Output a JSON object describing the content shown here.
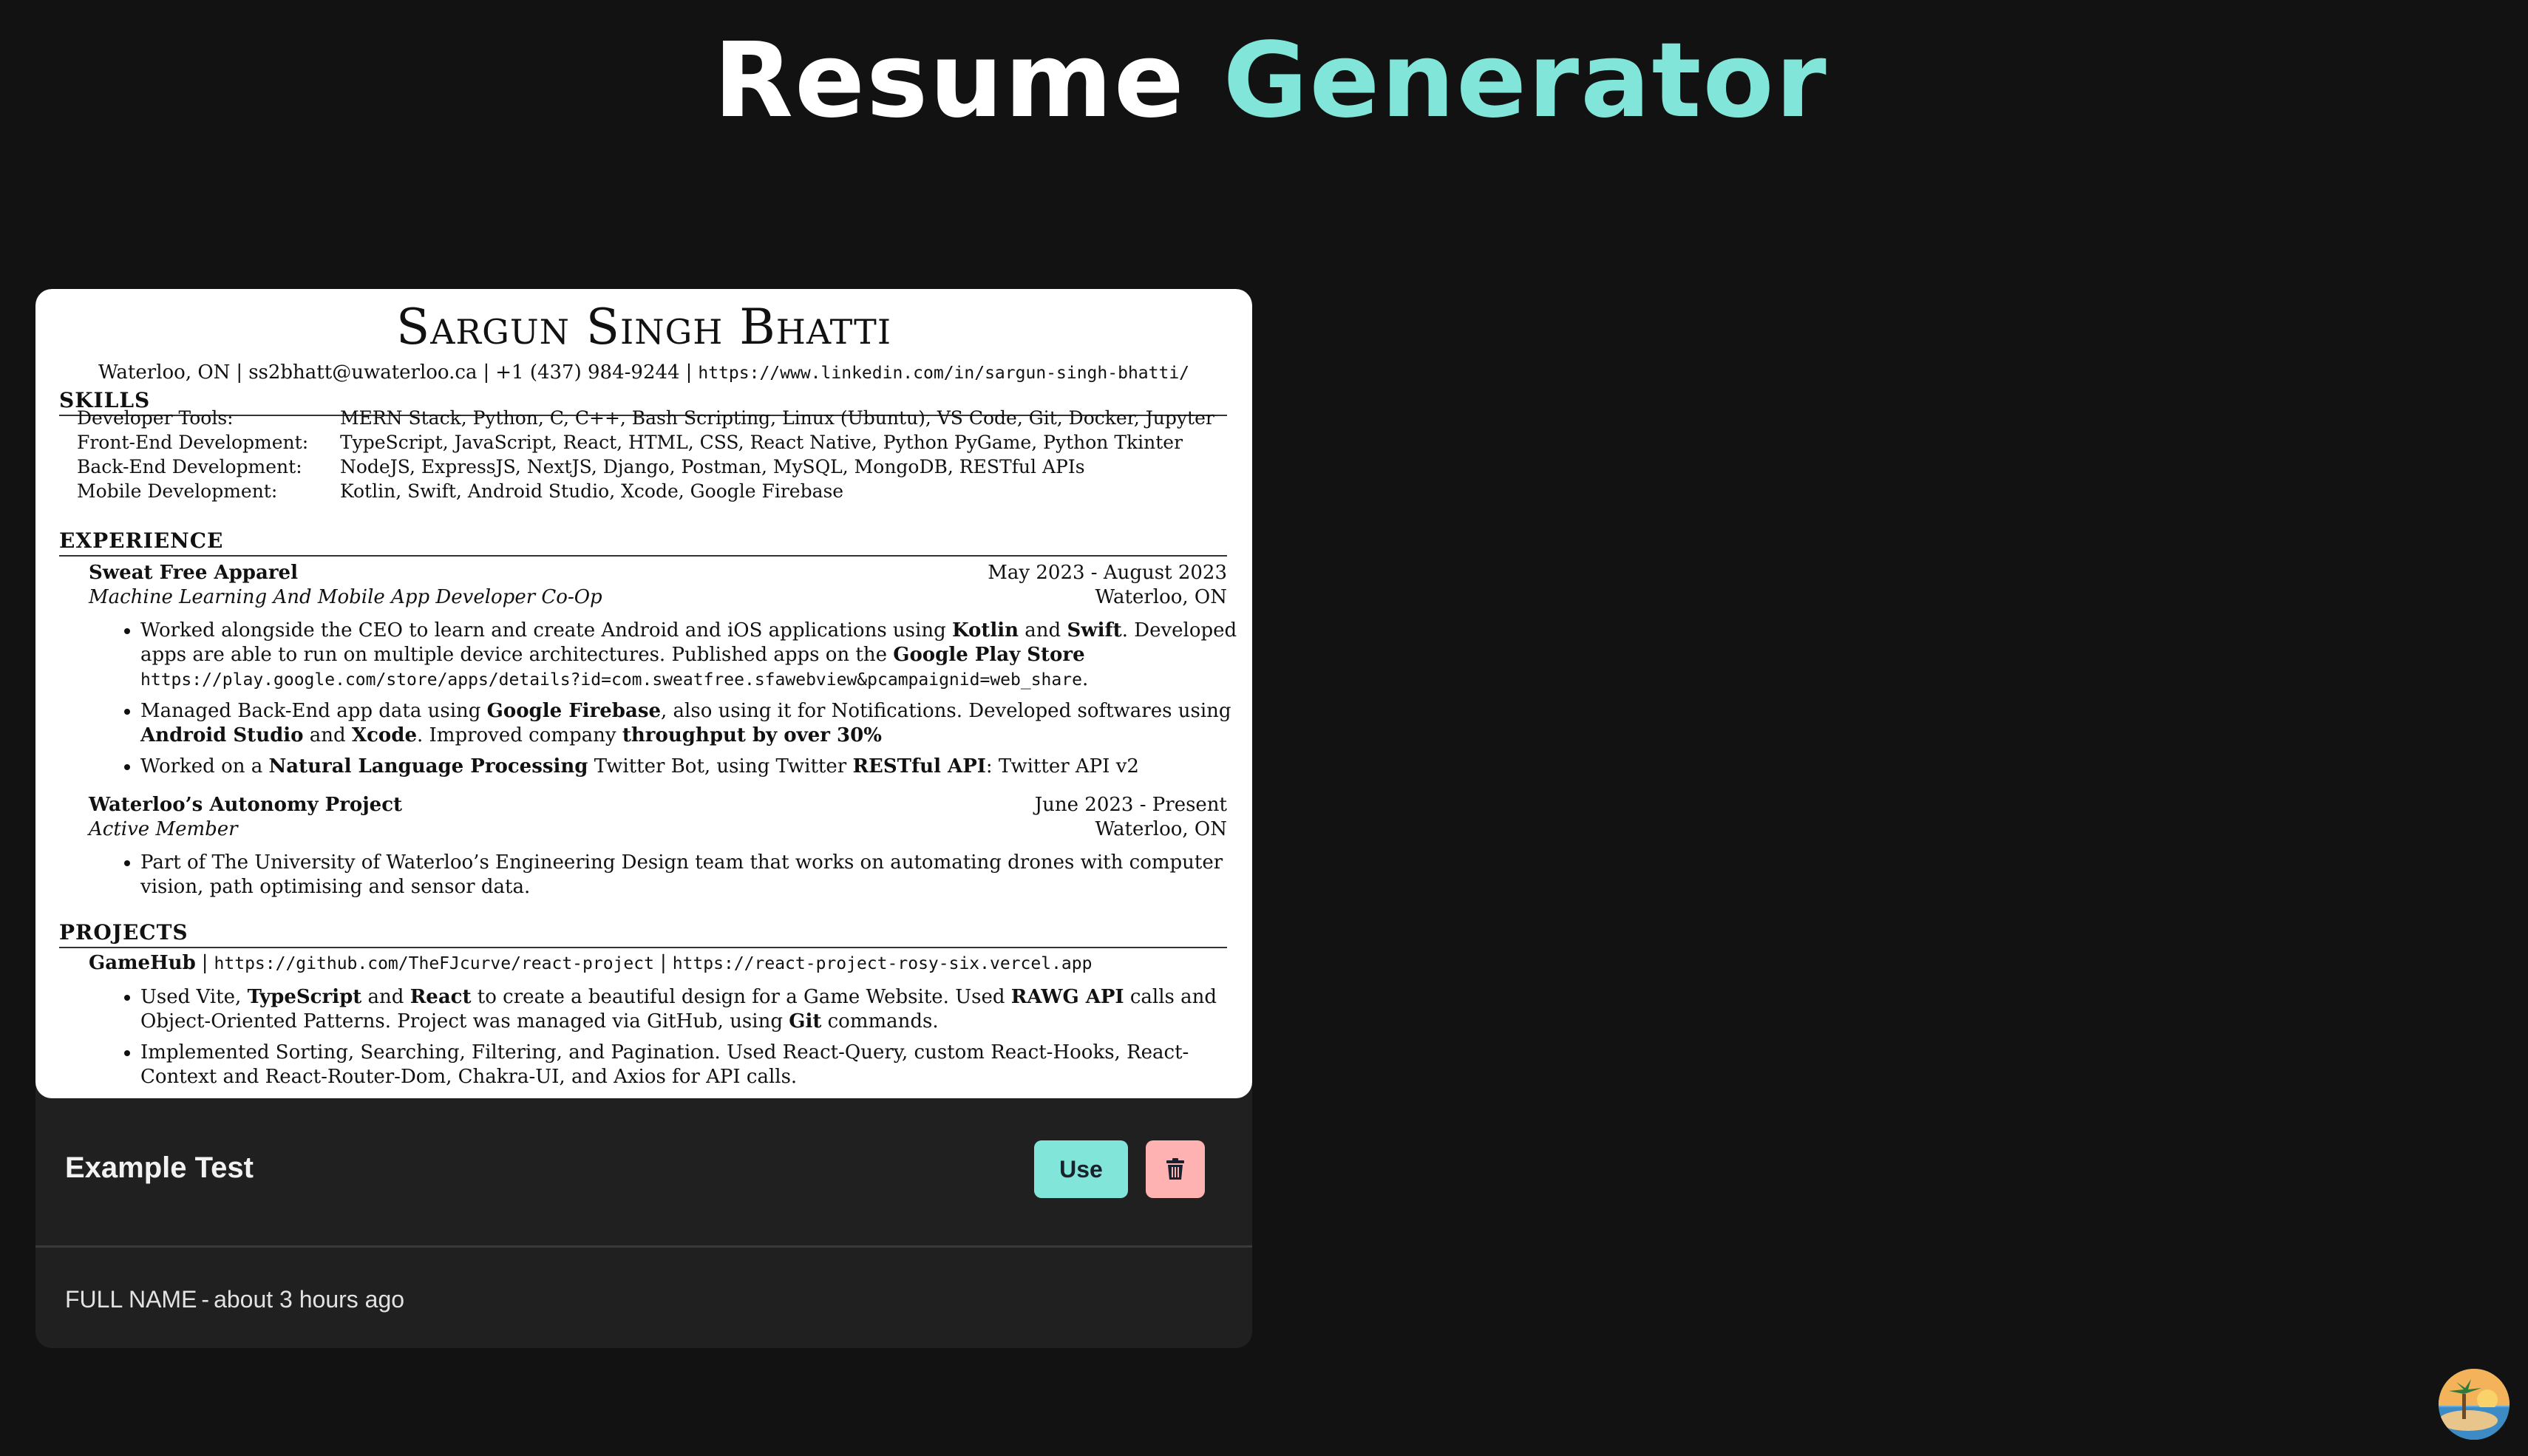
{
  "app": {
    "title_part_1": "Resume",
    "title_part_2": "Generator"
  },
  "card": {
    "title": "Example Test",
    "use_label": "Use",
    "delete_icon": "trash-icon",
    "author": "FULL NAME",
    "separator": "-",
    "time_ago": "about 3 hours ago"
  },
  "resume": {
    "name": "Sargun Singh Bhatti",
    "contact": {
      "location": "Waterloo, ON",
      "email": "ss2bhatt@uwaterloo.ca",
      "phone": "+1 (437) 984-9244",
      "linkedin": "https://www.linkedin.com/in/sargun-singh-bhatti/"
    },
    "sections": {
      "skills": "SKILLS",
      "experience": "EXPERIENCE",
      "projects": "PROJECTS"
    },
    "skills": [
      {
        "label": "Developer Tools:",
        "value": "MERN Stack, Python, C, C++, Bash Scripting, Linux (Ubuntu), VS Code, Git, Docker, Jupyter"
      },
      {
        "label": "Front-End Development:",
        "value": "TypeScript, JavaScript, React, HTML, CSS, React Native, Python PyGame, Python Tkinter"
      },
      {
        "label": "Back-End Development:",
        "value": "NodeJS, ExpressJS, NextJS, Django, Postman, MySQL, MongoDB, RESTful APIs"
      },
      {
        "label": "Mobile Development:",
        "value": "Kotlin, Swift, Android Studio, Xcode, Google Firebase"
      }
    ],
    "experience": [
      {
        "company": "Sweat Free Apparel",
        "dates": "May 2023 - August 2023",
        "role": "Machine Learning And Mobile App Developer Co-Op",
        "location": "Waterloo, ON",
        "b1": {
          "t1": "Worked alongside the CEO to learn and create Android and iOS applications using ",
          "k1": "Kotlin",
          "t2": " and ",
          "k2": "Swift",
          "t3": ". Developed apps are able to run on multiple device architectures. Published apps on the ",
          "k3": "Google Play Store",
          "url": "https://play.google.com/store/apps/details?id=com.sweatfree.sfawebview&pcampaignid=web_share",
          "t4": "."
        },
        "b2": {
          "t1": "Managed Back-End app data using ",
          "k1": "Google Firebase",
          "t2": ", also using it for Notifications. Developed softwares using ",
          "k2": "Android Studio",
          "t3": " and ",
          "k3": "Xcode",
          "t4": ". Improved company ",
          "k4": "throughput by over 30%"
        },
        "b3": {
          "t1": "Worked on a ",
          "k1": "Natural Language Processing",
          "t2": " Twitter Bot, using Twitter ",
          "k2": "RESTful API",
          "t3": ": Twitter API v2"
        }
      },
      {
        "company": "Waterloo’s Autonomy Project",
        "dates": "June 2023 - Present",
        "role": "Active Member",
        "location": "Waterloo, ON",
        "b1": "Part of The University of Waterloo’s Engineering Design team that works on automating drones with computer vision, path optimising and sensor data."
      }
    ],
    "project": {
      "name": "GameHub",
      "repo": "https://github.com/TheFJcurve/react-project",
      "site": "https://react-project-rosy-six.vercel.app",
      "b1": {
        "t1": "Used Vite, ",
        "k1": "TypeScript",
        "t2": " and ",
        "k2": "React",
        "t3": " to create a beautiful design for a Game Website. Used ",
        "k3": "RAWG API",
        "t4": " calls and Object-Oriented Patterns. Project was managed via GitHub, using ",
        "k4": "Git",
        "t5": " commands."
      },
      "b2": "Implemented Sorting, Searching, Filtering, and Pagination. Used React-Query, custom React-Hooks, React-Context and React-Router-Dom, Chakra-UI, and Axios for API calls."
    }
  },
  "avatar_icon": "user-avatar-icon",
  "colors": {
    "background": "#121212",
    "accent": "#81e6d9",
    "card": "#202020",
    "delete": "#feb2b2"
  }
}
